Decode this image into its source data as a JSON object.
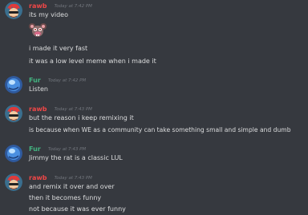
{
  "colors": {
    "background": "#36393f",
    "message_text": "#dcddde",
    "timestamp": "#72767d"
  },
  "messages": [
    {
      "author": "rawb",
      "author_color": "#f04747",
      "avatar_icon": "rawb-avatar-icon",
      "timestamp": "Today at 7:42 PM",
      "lines": [
        "its my video"
      ],
      "emoji": "rat-emoji-icon",
      "lines_after": [
        "i made it very fast",
        "it was a low level meme when i made it"
      ]
    },
    {
      "author": "Fur",
      "author_color": "#43b581",
      "avatar_icon": "fur-avatar-icon",
      "timestamp": "Today at 7:42 PM",
      "lines": [
        "Listen"
      ]
    },
    {
      "author": "rawb",
      "author_color": "#f04747",
      "avatar_icon": "rawb-avatar-icon",
      "timestamp": "Today at 7:43 PM",
      "lines": [
        "but the reason i keep remixing it",
        "is because when WE as a community can take something small and simple and dumb"
      ]
    },
    {
      "author": "Fur",
      "author_color": "#43b581",
      "avatar_icon": "fur-avatar-icon",
      "timestamp": "Today at 7:43 PM",
      "lines": [
        "Jimmy the rat is a classic LUL"
      ]
    },
    {
      "author": "rawb",
      "author_color": "#f04747",
      "avatar_icon": "rawb-avatar-icon",
      "timestamp": "Today at 7:43 PM",
      "lines": [
        "and remix it over and over",
        "then it becomes funny",
        "not because it was ever funny"
      ]
    }
  ]
}
